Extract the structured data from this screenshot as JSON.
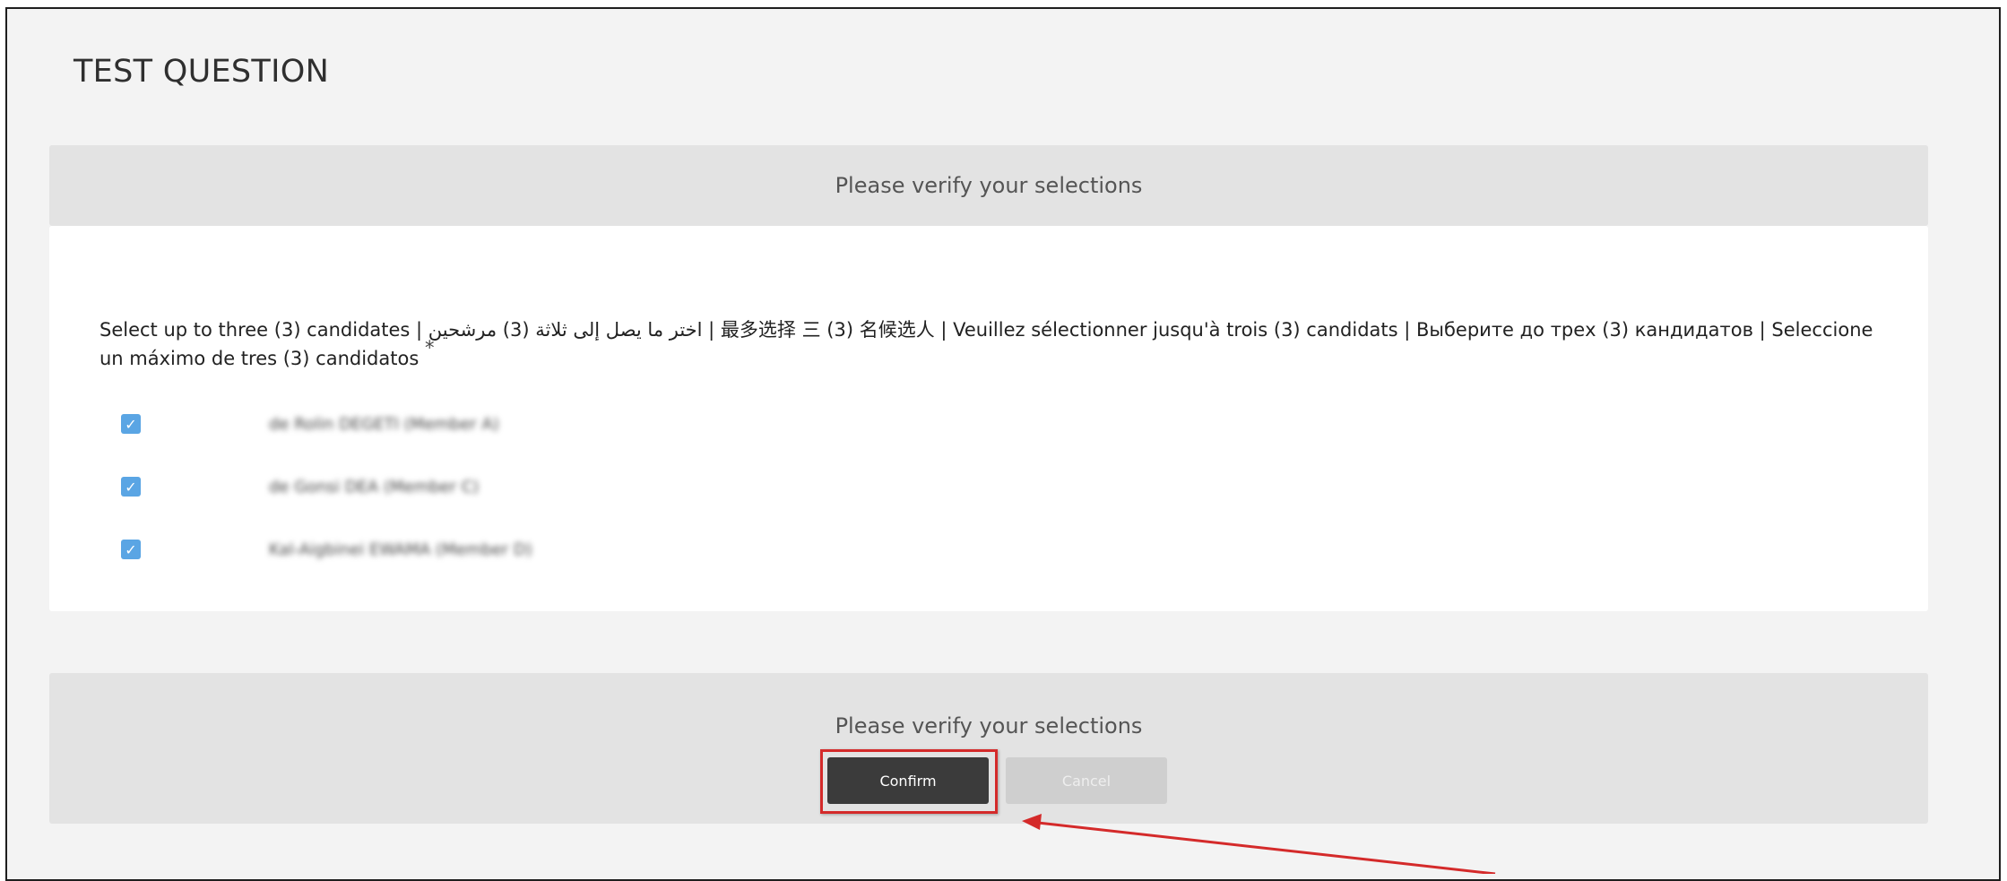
{
  "page": {
    "title": "TEST QUESTION"
  },
  "banner": {
    "text": "Please verify your selections"
  },
  "question": {
    "text": "Select up to three (3) candidates | اختر ما يصل إلى ثلاثة (3) مرشحين | 最多选择 三 (3) 名候选人 | Veuillez sélectionner jusqu'à trois (3) candidats | Выберите до трех (3) кандидатов | Seleccione un máximo de tres (3) candidatos",
    "required_marker": "*",
    "options": [
      {
        "checked": true,
        "check_glyph": "✓",
        "label": "de Rolin DEGETI (Member A)"
      },
      {
        "checked": true,
        "check_glyph": "✓",
        "label": "de Gonsi DEA (Member C)"
      },
      {
        "checked": true,
        "check_glyph": "✓",
        "label": "Kal-Aigbinei EWAMA (Member D)"
      }
    ]
  },
  "confirm_panel": {
    "text": "Please verify your selections",
    "confirm_label": "Confirm",
    "cancel_label": "Cancel"
  },
  "annotation": {
    "color": "#d42a2a",
    "icon": "arrow-icon"
  },
  "colors": {
    "checkbox": "#5aa5e4",
    "confirm_button": "#3b3b3b",
    "cancel_button": "#cfcfcf",
    "panel_background": "#e3e3e3"
  }
}
